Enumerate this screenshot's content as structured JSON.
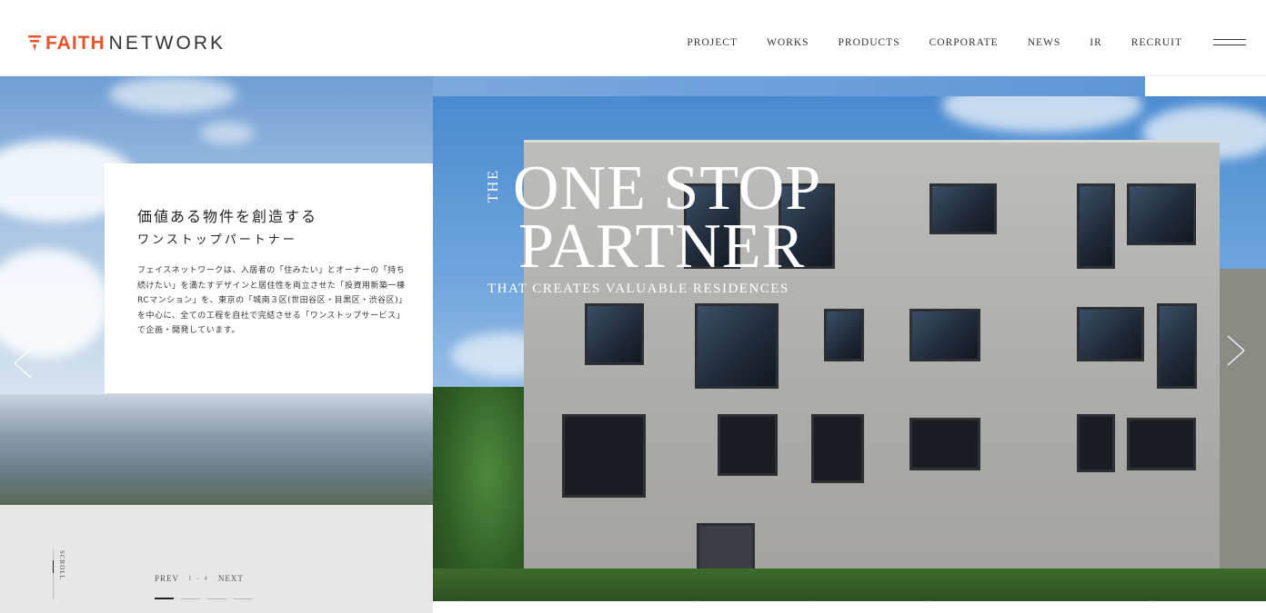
{
  "header": {
    "logo": {
      "brand_accent": "FAITH",
      "brand_rest": "NETWORK",
      "accent_color": "#e8542b"
    },
    "nav": [
      {
        "label": "PROJECT"
      },
      {
        "label": "WORKS"
      },
      {
        "label": "PRODUCTS"
      },
      {
        "label": "CORPORATE"
      },
      {
        "label": "NEWS"
      },
      {
        "label": "IR"
      },
      {
        "label": "RECRUIT"
      }
    ],
    "menu_icon": "hamburger-icon"
  },
  "intro": {
    "heading": "価値ある物件を創造する",
    "subheading": "ワンストップパートナー",
    "body": "フェイスネットワークは、入居者の「住みたい」とオーナーの「持ち続けたい」を満たすデザインと居住性を両立させた「投資用新築一棟RCマンション」を、東京の「城南３区(世田谷区・目黒区・渋谷区)」を中心に、全ての工程を自社で完結させる「ワンストップサービス」で企画・開発しています。"
  },
  "hero": {
    "the": "THE",
    "title_line1": "ONE STOP",
    "title_line2": "PARTNER",
    "tagline": "THAT CREATES VALUABLE RESIDENCES"
  },
  "slider": {
    "scroll_label": "SCROLL",
    "prev_label": "PREV",
    "counter": "1 - 4",
    "next_label": "NEXT",
    "total_slides": 4,
    "current_slide": 1,
    "left_arrow_icon": "chevron-left-icon",
    "right_arrow_icon": "chevron-right-icon"
  }
}
